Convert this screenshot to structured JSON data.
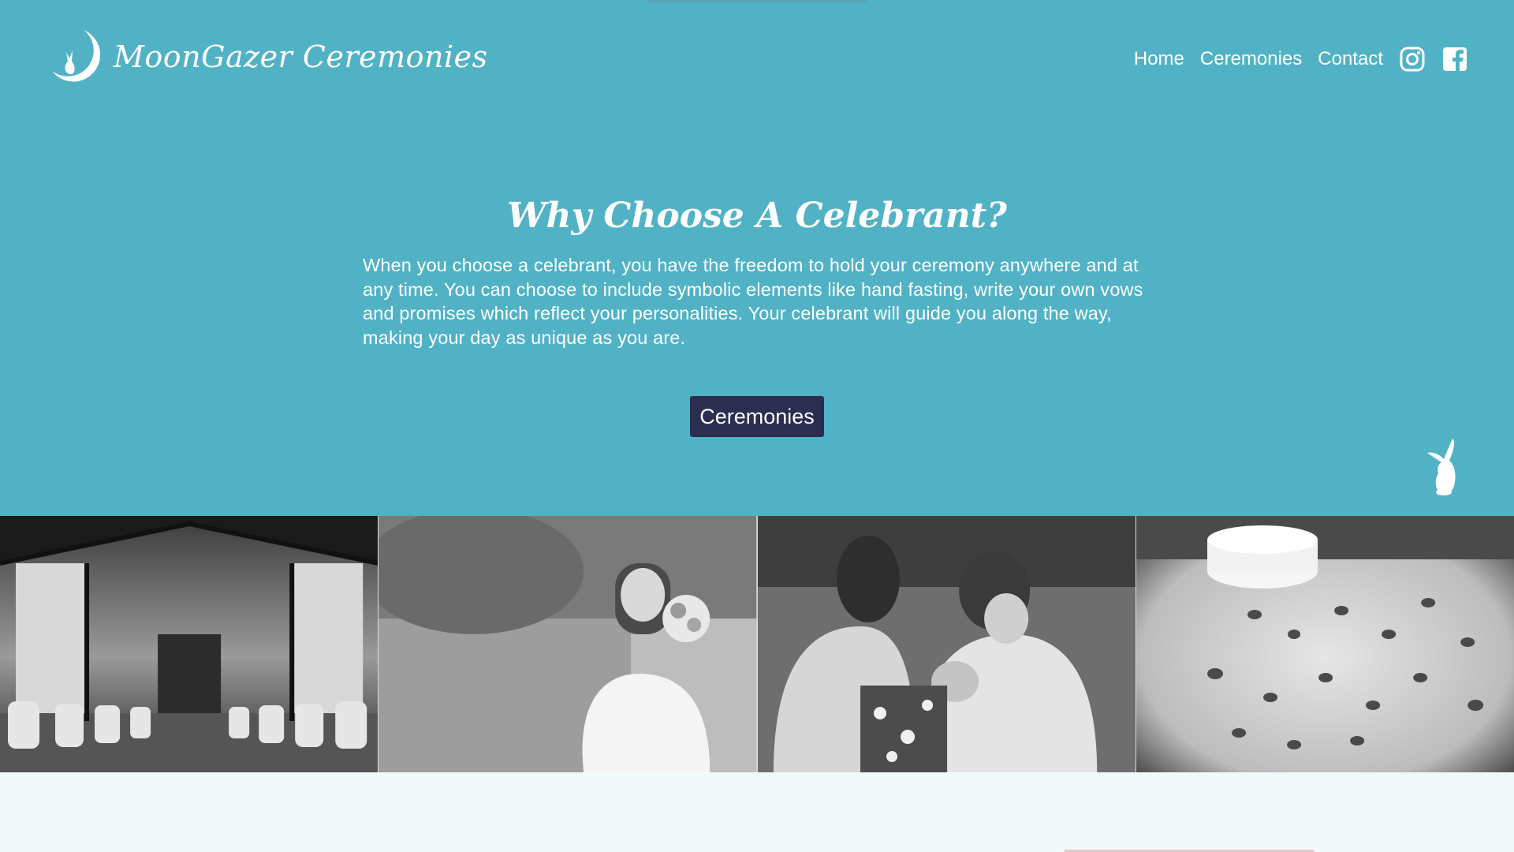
{
  "brand": {
    "name": "MoonGazer Ceremonies"
  },
  "nav": {
    "items": [
      {
        "label": "Home"
      },
      {
        "label": "Ceremonies"
      },
      {
        "label": "Contact"
      }
    ],
    "social": [
      {
        "icon": "instagram-icon"
      },
      {
        "icon": "facebook-icon"
      }
    ]
  },
  "hero": {
    "title": "Why Choose A Celebrant?",
    "body": "When you choose a celebrant, you have the freedom to hold your ceremony anywhere and at any time. You can choose to include symbolic elements like hand fasting, write your own vows and promises which reflect your personalities. Your celebrant will guide you along the way, making your day as unique as you are.",
    "cta_label": "Ceremonies"
  },
  "gallery": {
    "photos": [
      {
        "icon": "barn-venue-photo"
      },
      {
        "icon": "flower-girl-photo"
      },
      {
        "icon": "mother-baby-photo"
      },
      {
        "icon": "cake-table-photo"
      }
    ]
  },
  "colors": {
    "hero_bg": "#52b2c5",
    "button_bg": "#2b2e4f",
    "text": "#ffffff",
    "page_bg": "#f3f9fb"
  }
}
